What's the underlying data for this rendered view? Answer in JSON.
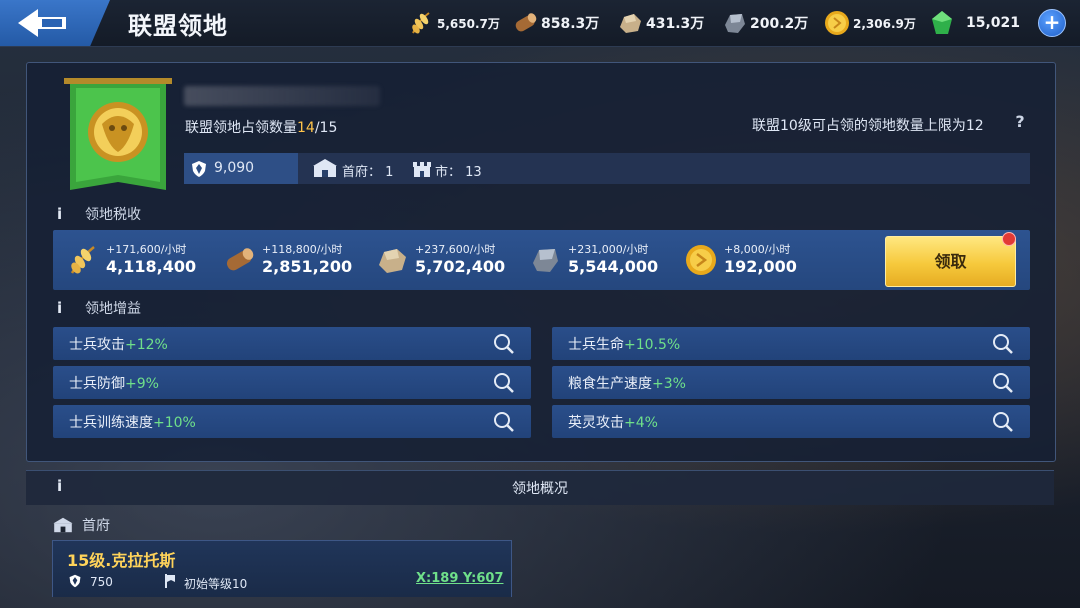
{
  "header": {
    "title": "联盟领地",
    "resources": [
      {
        "icon": "wheat-icon",
        "value": "5,650.7万"
      },
      {
        "icon": "wood-icon",
        "value": "858.3万"
      },
      {
        "icon": "stone-icon",
        "value": "431.3万"
      },
      {
        "icon": "iron-icon",
        "value": "200.2万"
      },
      {
        "icon": "gold-coin-icon",
        "value": "2,306.9万"
      },
      {
        "icon": "gem-icon",
        "value": "15,021"
      }
    ]
  },
  "territory": {
    "count_label": "联盟领地占领数量",
    "count_current": "14",
    "count_total": "/15",
    "limit_text": "联盟10级可占领的领地数量上限为12",
    "help": "?",
    "power": "9,090",
    "capital_label": "首府：",
    "capital_count": "1",
    "city_label": "市：",
    "city_count": "13"
  },
  "tax": {
    "section_title": "领地税收",
    "items": [
      {
        "icon": "wheat-icon",
        "rate": "+171,600/小时",
        "amount": "4,118,400"
      },
      {
        "icon": "wood-icon",
        "rate": "+118,800/小时",
        "amount": "2,851,200"
      },
      {
        "icon": "stone-icon",
        "rate": "+237,600/小时",
        "amount": "5,702,400"
      },
      {
        "icon": "iron-icon",
        "rate": "+231,000/小时",
        "amount": "5,544,000"
      },
      {
        "icon": "gold-coin-icon",
        "rate": "+8,000/小时",
        "amount": "192,000"
      }
    ],
    "claim_label": "领取"
  },
  "buffs": {
    "section_title": "领地增益",
    "items": [
      {
        "label": "士兵攻击",
        "value": "+12%"
      },
      {
        "label": "士兵生命",
        "value": "+10.5%"
      },
      {
        "label": "士兵防御",
        "value": "+9%"
      },
      {
        "label": "粮食生产速度",
        "value": "+3%"
      },
      {
        "label": "士兵训练速度",
        "value": "+10%"
      },
      {
        "label": "英灵攻击",
        "value": "+4%"
      }
    ]
  },
  "overview": {
    "title": "领地概况",
    "capital_heading": "首府",
    "city": {
      "name": "15级.克拉托斯",
      "power": "750",
      "level": "初始等级10",
      "coords": "X:189 Y:607"
    }
  },
  "colors": {
    "accent_blue": "#2d5390",
    "highlight_gold": "#ffc44a",
    "buff_green": "#6fe08a",
    "claim_yellow": "#f6c93c"
  }
}
